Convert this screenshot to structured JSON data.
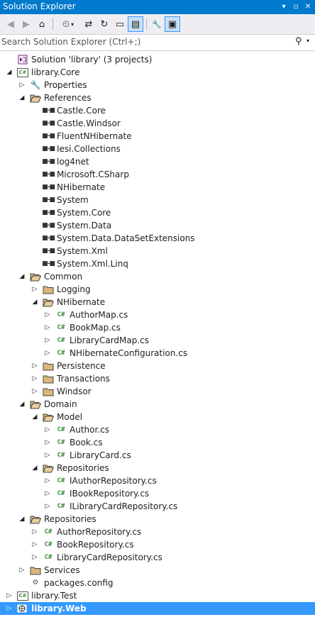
{
  "window": {
    "title": "Solution Explorer",
    "buttons": [
      "▾",
      "▫",
      "✕"
    ]
  },
  "toolbar": {
    "back": "◀",
    "forward": "▶",
    "home": "⌂",
    "history": "⏲",
    "history_dd": "▾",
    "sync": "⇄",
    "refresh": "↻",
    "collapse": "▭",
    "show_all": "▤",
    "properties": "🔧",
    "preview": "▣"
  },
  "search": {
    "placeholder": "Search Solution Explorer (Ctrl+;)",
    "value": "",
    "icon": "⚲",
    "dropdown": "▾"
  },
  "tree": [
    {
      "label": "Solution 'library' (3 projects)",
      "icon": "solution",
      "expander": "",
      "level": 0
    },
    {
      "label": "library.Core",
      "icon": "csproj",
      "expander": "expanded",
      "level": 0
    },
    {
      "label": "Properties",
      "icon": "wrench",
      "expander": "collapsed",
      "level": 1
    },
    {
      "label": "References",
      "icon": "folder-open",
      "expander": "expanded",
      "level": 1
    },
    {
      "label": "Castle.Core",
      "icon": "reference",
      "expander": "",
      "level": 2
    },
    {
      "label": "Castle.Windsor",
      "icon": "reference",
      "expander": "",
      "level": 2
    },
    {
      "label": "FluentNHibernate",
      "icon": "reference",
      "expander": "",
      "level": 2
    },
    {
      "label": "Iesi.Collections",
      "icon": "reference",
      "expander": "",
      "level": 2
    },
    {
      "label": "log4net",
      "icon": "reference",
      "expander": "",
      "level": 2
    },
    {
      "label": "Microsoft.CSharp",
      "icon": "reference",
      "expander": "",
      "level": 2
    },
    {
      "label": "NHibernate",
      "icon": "reference",
      "expander": "",
      "level": 2
    },
    {
      "label": "System",
      "icon": "reference",
      "expander": "",
      "level": 2
    },
    {
      "label": "System.Core",
      "icon": "reference",
      "expander": "",
      "level": 2
    },
    {
      "label": "System.Data",
      "icon": "reference",
      "expander": "",
      "level": 2
    },
    {
      "label": "System.Data.DataSetExtensions",
      "icon": "reference",
      "expander": "",
      "level": 2
    },
    {
      "label": "System.Xml",
      "icon": "reference",
      "expander": "",
      "level": 2
    },
    {
      "label": "System.Xml.Linq",
      "icon": "reference",
      "expander": "",
      "level": 2
    },
    {
      "label": "Common",
      "icon": "folder-open",
      "expander": "expanded",
      "level": 1
    },
    {
      "label": "Logging",
      "icon": "folder",
      "expander": "collapsed",
      "level": 2
    },
    {
      "label": "NHibernate",
      "icon": "folder-open",
      "expander": "expanded",
      "level": 2
    },
    {
      "label": "AuthorMap.cs",
      "icon": "cs",
      "expander": "collapsed",
      "level": 3
    },
    {
      "label": "BookMap.cs",
      "icon": "cs",
      "expander": "collapsed",
      "level": 3
    },
    {
      "label": "LibraryCardMap.cs",
      "icon": "cs",
      "expander": "collapsed",
      "level": 3
    },
    {
      "label": "NHibernateConfiguration.cs",
      "icon": "cs",
      "expander": "collapsed",
      "level": 3
    },
    {
      "label": "Persistence",
      "icon": "folder",
      "expander": "collapsed",
      "level": 2
    },
    {
      "label": "Transactions",
      "icon": "folder",
      "expander": "collapsed",
      "level": 2
    },
    {
      "label": "Windsor",
      "icon": "folder",
      "expander": "collapsed",
      "level": 2
    },
    {
      "label": "Domain",
      "icon": "folder-open",
      "expander": "expanded",
      "level": 1
    },
    {
      "label": "Model",
      "icon": "folder-open",
      "expander": "expanded",
      "level": 2
    },
    {
      "label": "Author.cs",
      "icon": "cs",
      "expander": "collapsed",
      "level": 3
    },
    {
      "label": "Book.cs",
      "icon": "cs",
      "expander": "collapsed",
      "level": 3
    },
    {
      "label": "LibraryCard.cs",
      "icon": "cs",
      "expander": "collapsed",
      "level": 3
    },
    {
      "label": "Repositories",
      "icon": "folder-open",
      "expander": "expanded",
      "level": 2
    },
    {
      "label": "IAuthorRepository.cs",
      "icon": "cs",
      "expander": "collapsed",
      "level": 3
    },
    {
      "label": "IBookRepository.cs",
      "icon": "cs",
      "expander": "collapsed",
      "level": 3
    },
    {
      "label": "ILibraryCardRepository.cs",
      "icon": "cs",
      "expander": "collapsed",
      "level": 3
    },
    {
      "label": "Repositories",
      "icon": "folder-open",
      "expander": "expanded",
      "level": 1
    },
    {
      "label": "AuthorRepository.cs",
      "icon": "cs",
      "expander": "collapsed",
      "level": 2
    },
    {
      "label": "BookRepository.cs",
      "icon": "cs",
      "expander": "collapsed",
      "level": 2
    },
    {
      "label": "LibraryCardRepository.cs",
      "icon": "cs",
      "expander": "collapsed",
      "level": 2
    },
    {
      "label": "Services",
      "icon": "folder",
      "expander": "collapsed",
      "level": 1
    },
    {
      "label": "packages.config",
      "icon": "config",
      "expander": "",
      "level": 1
    },
    {
      "label": "library.Test",
      "icon": "csproj",
      "expander": "collapsed",
      "level": 0
    },
    {
      "label": "library.Web",
      "icon": "webproj",
      "expander": "collapsed",
      "level": 0,
      "selected": true
    }
  ],
  "glyphs": {
    "expanded": "◢",
    "collapsed": "▷",
    "cs": "C#",
    "csproj": "C#",
    "reference": "■-■",
    "wrench": "🔧",
    "config": "⚙"
  },
  "colors": {
    "title_bg": "#007acc",
    "selection": "#3399ff",
    "folder": "#dcb67a",
    "cs_green": "#388a34"
  }
}
